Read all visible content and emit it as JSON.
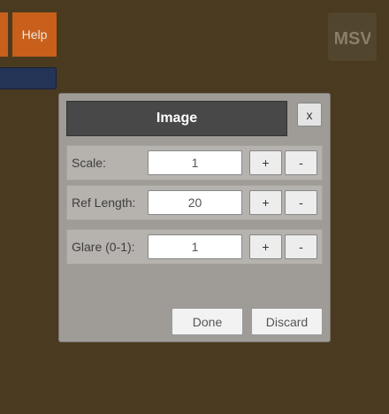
{
  "toolbar": {
    "help_label": "Help",
    "logo_text": "MSV"
  },
  "dialog": {
    "title": "Image",
    "close_label": "x",
    "rows": [
      {
        "label": "Scale:",
        "value": "1",
        "plus": "+",
        "minus": "-"
      },
      {
        "label": "Ref Length:",
        "value": "20",
        "plus": "+",
        "minus": "-"
      },
      {
        "label": "Glare (0-1):",
        "value": "1",
        "plus": "+",
        "minus": "-"
      }
    ],
    "done_label": "Done",
    "discard_label": "Discard"
  },
  "colors": {
    "background": "#4a3a20",
    "accent_orange": "#c8601b",
    "bar_blue": "#233457",
    "dialog_gray": "#9f9c98",
    "title_bar": "#484848"
  }
}
